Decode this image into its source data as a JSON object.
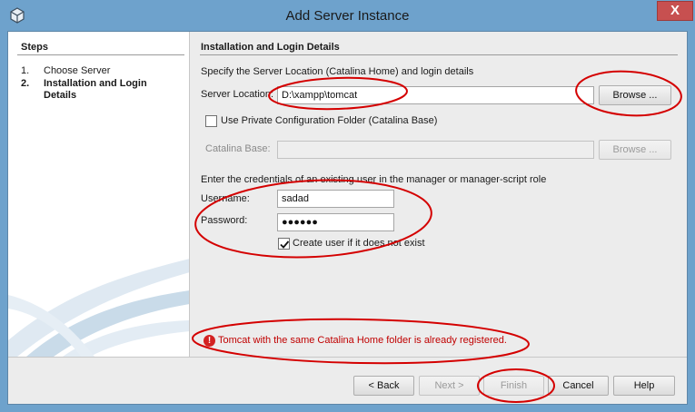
{
  "window": {
    "title": "Add Server Instance",
    "close_glyph": "X"
  },
  "steps": {
    "title": "Steps",
    "items": [
      {
        "num": "1.",
        "label": "Choose Server"
      },
      {
        "num": "2.",
        "label": "Installation and Login Details"
      }
    ]
  },
  "section": {
    "title": "Installation and Login Details",
    "intro": "Specify the Server Location (Catalina Home) and login details"
  },
  "server_location": {
    "label": "Server Location:",
    "value": "D:\\xampp\\tomcat",
    "browse_label": "Browse ..."
  },
  "private_config": {
    "label": "Use Private Configuration Folder (Catalina Base)",
    "checked": false
  },
  "catalina_base": {
    "label": "Catalina Base:",
    "value": "",
    "browse_label": "Browse ..."
  },
  "credentials": {
    "intro": "Enter the credentials of an existing user in the manager or manager-script role",
    "username_label": "Username:",
    "username_value": "sadad",
    "password_label": "Password:",
    "password_value": "●●●●●●",
    "create_user_label": "Create user if it does not exist",
    "create_user_checked": true
  },
  "error": {
    "icon_glyph": "!",
    "message": "Tomcat with the same Catalina Home folder is already registered."
  },
  "buttons": {
    "back": "< Back",
    "next": "Next >",
    "finish": "Finish",
    "cancel": "Cancel",
    "help": "Help"
  },
  "colors": {
    "titlebar": "#6ea2cc",
    "error": "#c00000",
    "annotation": "#d40000"
  }
}
